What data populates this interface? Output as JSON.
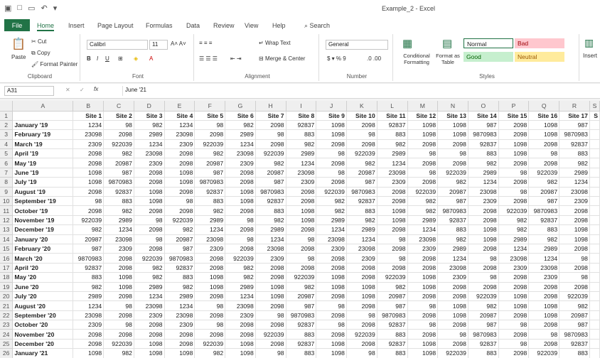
{
  "window": {
    "title": "Example_2  -  Excel"
  },
  "tabs": [
    "File",
    "Home",
    "Insert",
    "Page Layout",
    "Formulas",
    "Data",
    "Review",
    "View",
    "Help",
    "Search"
  ],
  "ribbon": {
    "cut": "Cut",
    "copy": "Copy",
    "paste": "Paste",
    "format_painter": "Format Painter",
    "clipboard": "Clipboard",
    "font_name": "Calibri",
    "font_size": "11",
    "font": "Font",
    "wrap_text": "Wrap Text",
    "merge_center": "Merge & Center",
    "alignment": "Alignment",
    "number_format": "General",
    "number": "Number",
    "conditional_formatting": "Conditional Formatting",
    "format_as_table": "Format as Table",
    "style_normal": "Normal",
    "style_bad": "Bad",
    "style_good": "Good",
    "style_neutral": "Neutral",
    "styles": "Styles",
    "insert": "Insert"
  },
  "formula_bar": {
    "name_box": "A31",
    "formula": "June '21"
  },
  "sheet": {
    "columns": [
      "A",
      "B",
      "C",
      "D",
      "E",
      "F",
      "G",
      "H",
      "I",
      "J",
      "K",
      "L",
      "M",
      "N",
      "O",
      "P",
      "Q",
      "R",
      "S"
    ],
    "headers": [
      "",
      "Site 1",
      "Site 2",
      "Site 3",
      "Site 4",
      "Site 5",
      "Site 6",
      "Site 7",
      "Site 8",
      "Site 9",
      "Site 10",
      "Site 11",
      "Site 12",
      "Site 13",
      "Site 14",
      "Site 15",
      "Site 16",
      "Site 17",
      "S"
    ],
    "rows": [
      [
        "January '19",
        "1234",
        "98",
        "982",
        "1234",
        "98",
        "982",
        "2098",
        "92837",
        "1098",
        "2098",
        "92837",
        "1098",
        "1098",
        "987",
        "2098",
        "1098",
        "987"
      ],
      [
        "February '19",
        "23098",
        "2098",
        "2989",
        "23098",
        "2098",
        "2989",
        "98",
        "883",
        "1098",
        "98",
        "883",
        "1098",
        "1098",
        "9870983",
        "2098",
        "1098",
        "9870983"
      ],
      [
        "March '19",
        "2309",
        "922039",
        "1234",
        "2309",
        "922039",
        "1234",
        "2098",
        "982",
        "2098",
        "2098",
        "982",
        "2098",
        "2098",
        "92837",
        "1098",
        "2098",
        "92837"
      ],
      [
        "April '19",
        "2098",
        "982",
        "23098",
        "2098",
        "982",
        "23098",
        "922039",
        "2989",
        "98",
        "922039",
        "2989",
        "98",
        "98",
        "883",
        "1098",
        "98",
        "883"
      ],
      [
        "May '19",
        "2098",
        "20987",
        "2309",
        "2098",
        "20987",
        "2309",
        "982",
        "1234",
        "2098",
        "982",
        "1234",
        "2098",
        "2098",
        "982",
        "2098",
        "2098",
        "982"
      ],
      [
        "June '19",
        "1098",
        "987",
        "2098",
        "1098",
        "987",
        "2098",
        "20987",
        "23098",
        "98",
        "20987",
        "23098",
        "98",
        "922039",
        "2989",
        "98",
        "922039",
        "2989"
      ],
      [
        "July '19",
        "1098",
        "9870983",
        "2098",
        "1098",
        "9870983",
        "2098",
        "987",
        "2309",
        "2098",
        "987",
        "2309",
        "2098",
        "982",
        "1234",
        "2098",
        "982",
        "1234"
      ],
      [
        "August '19",
        "2098",
        "92837",
        "1098",
        "2098",
        "92837",
        "1098",
        "9870983",
        "2098",
        "922039",
        "9870983",
        "2098",
        "922039",
        "20987",
        "23098",
        "98",
        "20987",
        "23098"
      ],
      [
        "September '19",
        "98",
        "883",
        "1098",
        "98",
        "883",
        "1098",
        "92837",
        "2098",
        "982",
        "92837",
        "2098",
        "982",
        "987",
        "2309",
        "2098",
        "987",
        "2309"
      ],
      [
        "October '19",
        "2098",
        "982",
        "2098",
        "2098",
        "982",
        "2098",
        "883",
        "1098",
        "982",
        "883",
        "1098",
        "982",
        "9870983",
        "2098",
        "922039",
        "9870983",
        "2098"
      ],
      [
        "November '19",
        "922039",
        "2989",
        "98",
        "922039",
        "2989",
        "98",
        "982",
        "1098",
        "2989",
        "982",
        "1098",
        "2989",
        "92837",
        "2098",
        "982",
        "92837",
        "2098"
      ],
      [
        "December '19",
        "982",
        "1234",
        "2098",
        "982",
        "1234",
        "2098",
        "2989",
        "2098",
        "1234",
        "2989",
        "2098",
        "1234",
        "883",
        "1098",
        "982",
        "883",
        "1098"
      ],
      [
        "January '20",
        "20987",
        "23098",
        "98",
        "20987",
        "23098",
        "98",
        "1234",
        "98",
        "23098",
        "1234",
        "98",
        "23098",
        "982",
        "1098",
        "2989",
        "982",
        "1098"
      ],
      [
        "February '20",
        "987",
        "2309",
        "2098",
        "987",
        "2309",
        "2098",
        "23098",
        "2098",
        "2309",
        "23098",
        "2098",
        "2309",
        "2989",
        "2098",
        "1234",
        "2989",
        "2098"
      ],
      [
        "March '20",
        "9870983",
        "2098",
        "922039",
        "9870983",
        "2098",
        "922039",
        "2309",
        "98",
        "2098",
        "2309",
        "98",
        "2098",
        "1234",
        "98",
        "23098",
        "1234",
        "98"
      ],
      [
        "April '20",
        "92837",
        "2098",
        "982",
        "92837",
        "2098",
        "982",
        "2098",
        "2098",
        "2098",
        "2098",
        "2098",
        "2098",
        "23098",
        "2098",
        "2309",
        "23098",
        "2098"
      ],
      [
        "May '20",
        "883",
        "1098",
        "982",
        "883",
        "1098",
        "982",
        "2098",
        "922039",
        "1098",
        "2098",
        "922039",
        "1098",
        "2309",
        "98",
        "2098",
        "2309",
        "98"
      ],
      [
        "June '20",
        "982",
        "1098",
        "2989",
        "982",
        "1098",
        "2989",
        "1098",
        "982",
        "1098",
        "1098",
        "982",
        "1098",
        "2098",
        "2098",
        "2098",
        "2098",
        "2098"
      ],
      [
        "July '20",
        "2989",
        "2098",
        "1234",
        "2989",
        "2098",
        "1234",
        "1098",
        "20987",
        "2098",
        "1098",
        "20987",
        "2098",
        "2098",
        "922039",
        "1098",
        "2098",
        "922039"
      ],
      [
        "August '20",
        "1234",
        "98",
        "23098",
        "1234",
        "98",
        "23098",
        "2098",
        "987",
        "98",
        "2098",
        "987",
        "98",
        "1098",
        "982",
        "1098",
        "1098",
        "982"
      ],
      [
        "September '20",
        "23098",
        "2098",
        "2309",
        "23098",
        "2098",
        "2309",
        "98",
        "9870983",
        "2098",
        "98",
        "9870983",
        "2098",
        "1098",
        "20987",
        "2098",
        "1098",
        "20987"
      ],
      [
        "October '20",
        "2309",
        "98",
        "2098",
        "2309",
        "98",
        "2098",
        "2098",
        "92837",
        "98",
        "2098",
        "92837",
        "98",
        "2098",
        "987",
        "98",
        "2098",
        "987"
      ],
      [
        "November '20",
        "2098",
        "2098",
        "2098",
        "2098",
        "2098",
        "2098",
        "922039",
        "883",
        "2098",
        "922039",
        "883",
        "2098",
        "98",
        "9870983",
        "2098",
        "98",
        "9870983"
      ],
      [
        "December '20",
        "2098",
        "922039",
        "1098",
        "2098",
        "922039",
        "1098",
        "2098",
        "92837",
        "1098",
        "2098",
        "92837",
        "1098",
        "2098",
        "92837",
        "98",
        "2098",
        "92837"
      ],
      [
        "January '21",
        "1098",
        "982",
        "1098",
        "1098",
        "982",
        "1098",
        "98",
        "883",
        "1098",
        "98",
        "883",
        "1098",
        "922039",
        "883",
        "2098",
        "922039",
        "883"
      ]
    ]
  }
}
